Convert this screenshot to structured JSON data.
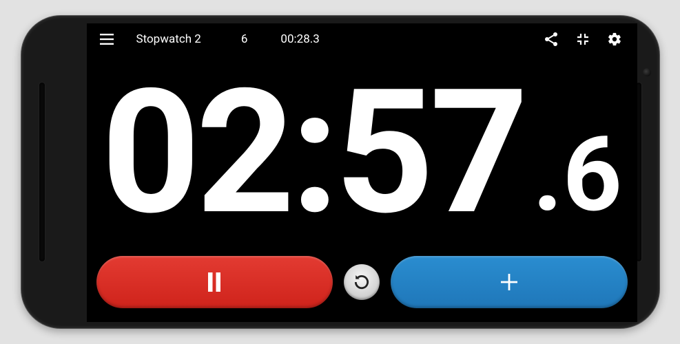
{
  "header": {
    "title": "Stopwatch 2",
    "lap_count": "6",
    "lap_time": "00:28.3"
  },
  "time": {
    "main": "02:57",
    "tenth": ".6"
  },
  "icons": {
    "menu": "menu",
    "share": "share",
    "collapse": "collapse",
    "settings": "settings",
    "pause": "pause",
    "reset": "reset",
    "add": "add"
  }
}
